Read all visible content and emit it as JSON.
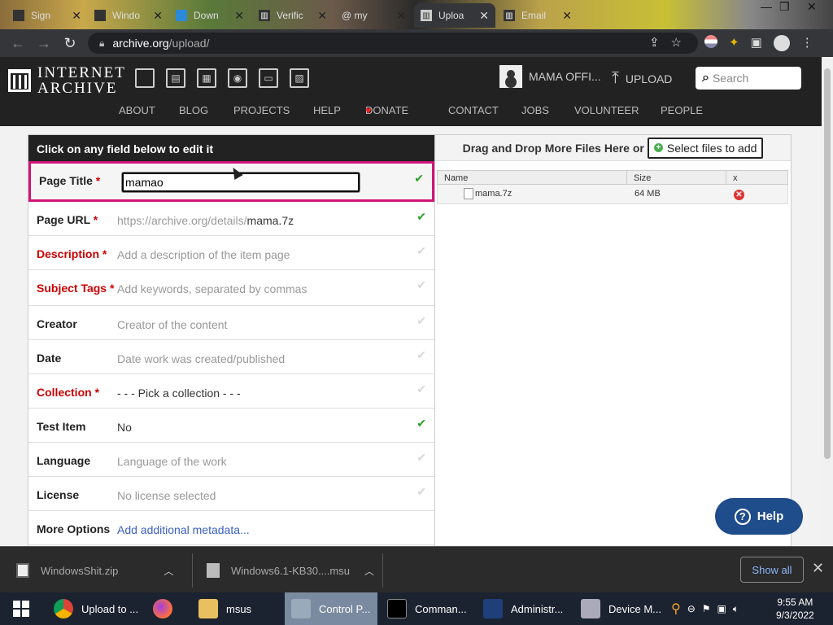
{
  "browser": {
    "tabs": [
      {
        "label": "Sign",
        "active": false
      },
      {
        "label": "Windo",
        "active": false
      },
      {
        "label": "Down",
        "active": false
      },
      {
        "label": "Verific",
        "active": false
      },
      {
        "label": "@ my",
        "active": false
      },
      {
        "label": "Uploa",
        "active": true
      },
      {
        "label": "Email",
        "active": false
      }
    ],
    "url_host": "archive.org",
    "url_path": "/upload/"
  },
  "site": {
    "logo_line1": "INTERNET",
    "logo_line2": "ARCHIVE",
    "user_name": "MAMA OFFI...",
    "upload_label": "UPLOAD",
    "search_placeholder": "Search",
    "nav": [
      "ABOUT",
      "BLOG",
      "PROJECTS",
      "HELP",
      "DONATE",
      "CONTACT",
      "JOBS",
      "VOLUNTEER",
      "PEOPLE"
    ]
  },
  "form": {
    "header": "Click on any field below to edit it",
    "fields": [
      {
        "label": "Page Title",
        "required": true,
        "value": "mamao",
        "status": "ok"
      },
      {
        "label": "Page URL",
        "required": true,
        "value_prefix": "https://archive.org/details/",
        "value": "mama.7z",
        "status": "ok"
      },
      {
        "label": "Description",
        "required": true,
        "value": "Add a description of the item page",
        "status": "pending"
      },
      {
        "label": "Subject Tags",
        "required": true,
        "value": "Add keywords, separated by commas",
        "status": "pending"
      },
      {
        "label": "Creator",
        "required": false,
        "value": "Creator of the content",
        "status": "pending"
      },
      {
        "label": "Date",
        "required": false,
        "value": "Date work was created/published",
        "status": "pending"
      },
      {
        "label": "Collection",
        "required": true,
        "value": "- - - Pick a collection - - -",
        "status": "pending"
      },
      {
        "label": "Test Item",
        "required": false,
        "value": "No",
        "status": "ok"
      },
      {
        "label": "Language",
        "required": false,
        "value": "Language of the work",
        "status": "pending"
      },
      {
        "label": "License",
        "required": false,
        "value": "No license selected",
        "status": "pending"
      },
      {
        "label": "More Options",
        "required": false,
        "value": "Add additional metadata...",
        "status": "none"
      }
    ]
  },
  "files": {
    "header": "Drag and Drop More Files Here or",
    "select_button": "Select files to add",
    "columns": [
      "Name",
      "Size",
      "x"
    ],
    "rows": [
      {
        "name": "mama.7z",
        "size": "64 MB"
      }
    ]
  },
  "help_button": "Help",
  "downloads": {
    "items": [
      "WindowsShit.zip",
      "Windows6.1-KB30....msu"
    ],
    "show_all": "Show all"
  },
  "taskbar": {
    "items": [
      "Upload to ...",
      "msus",
      "Control P...",
      "Comman...",
      "Administr...",
      "Device M..."
    ],
    "time": "9:55 AM",
    "date": "9/3/2022"
  },
  "colors": {
    "header_bg": "#222222",
    "active_field_border": "#d0147a",
    "required_label": "#cc0000",
    "ok_check": "#2aa02a",
    "help_button": "#1f4c8a"
  }
}
